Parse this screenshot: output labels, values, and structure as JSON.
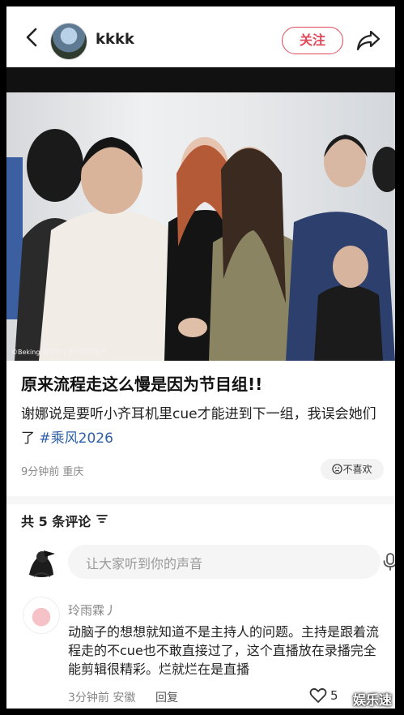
{
  "header": {
    "username": "kkkk",
    "follow_label": "关注"
  },
  "post": {
    "image_caption": "©Beking 是社牛 | 乘风综艺官方",
    "title": "原来流程走这么慢是因为节目组!!",
    "description": "谢娜说是要听小齐耳机里cue才能进到下一组，我误会她们了",
    "hashtag": "#乘风2026",
    "meta": "9分钟前 重庆",
    "dislike_label": "不喜欢"
  },
  "comments_section": {
    "count_label": "共 5 条评论",
    "input_placeholder": "让大家听到你的声音",
    "items": [
      {
        "username": "玲雨霖丿",
        "text": "动脑子的想想就知道不是主持人的问题。主持是跟着流程走的不cue也不敢直接过了，这个直播放在录播完全能剪辑很精彩。烂就烂在是直播",
        "meta": "3分钟前 安徽",
        "reply_label": "回复",
        "likes": "5"
      }
    ]
  },
  "watermark": "娱乐速递",
  "icons": {
    "back": "chevron-left-icon",
    "share": "share-arrow-icon",
    "dislike": "sad-face-icon",
    "sort": "sort-lines-icon",
    "mic": "microphone-icon",
    "image": "image-icon",
    "like": "heart-icon"
  },
  "colors": {
    "accent": "#e0485a",
    "hashtag": "#2d5fa8"
  }
}
